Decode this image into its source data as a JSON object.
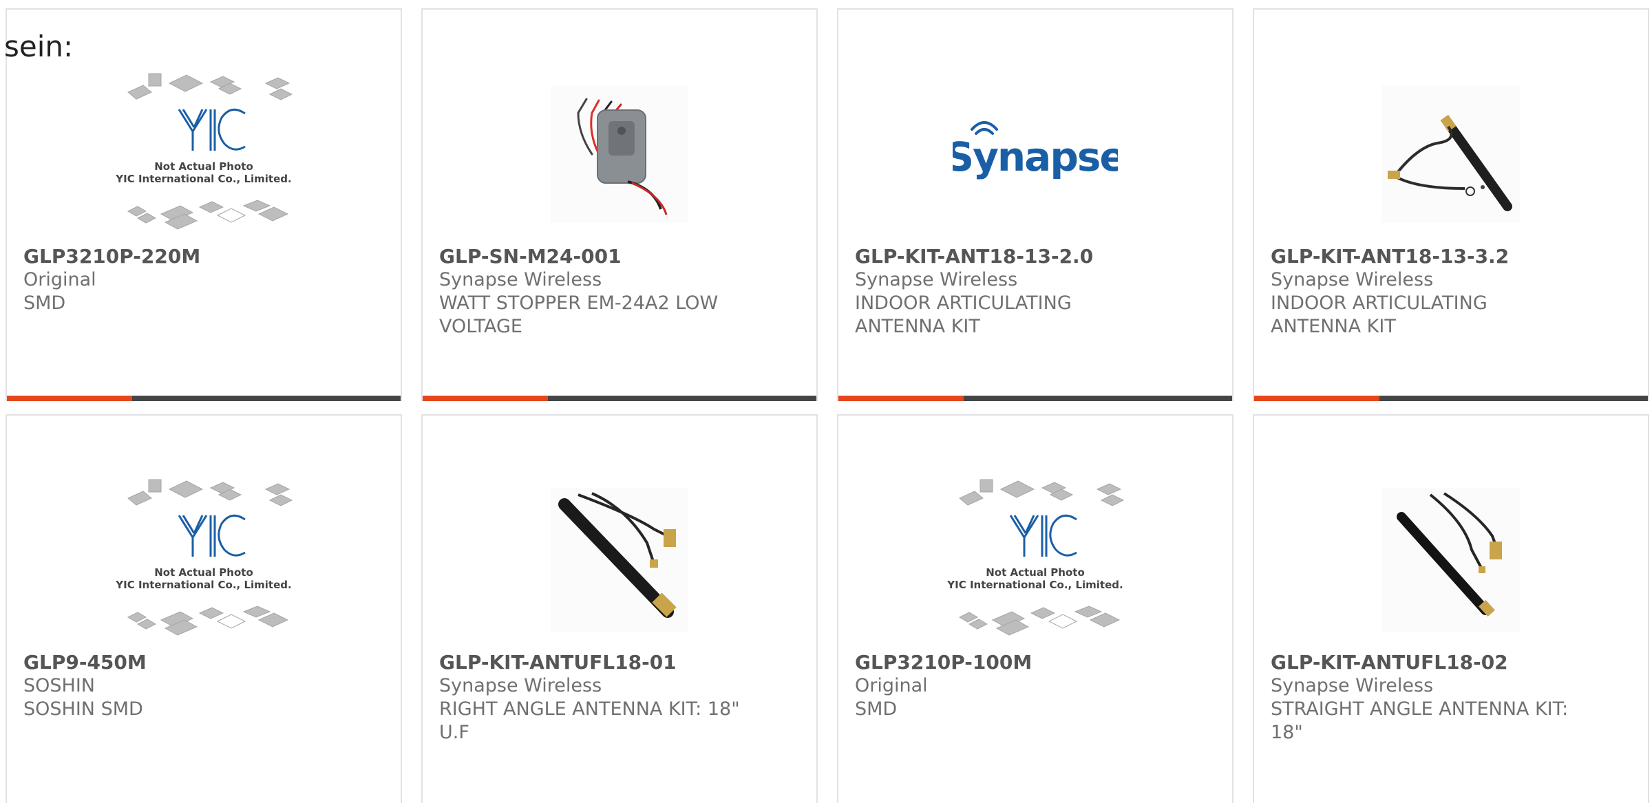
{
  "intro_text": "sein:",
  "placeholder": {
    "line1": "Not Actual Photo",
    "line2": "YIC International Co., Limited."
  },
  "brand_logo_text": "Synapse",
  "cards": [
    {
      "part": "GLP3210P-220M",
      "brand": "Original",
      "desc": "SMD",
      "image": "yic-placeholder"
    },
    {
      "part": "GLP-SN-M24-001",
      "brand": "Synapse Wireless",
      "desc": "WATT STOPPER EM-24A2 LOW VOLTAGE",
      "image": "sensor-photo"
    },
    {
      "part": "GLP-KIT-ANT18-13-2.0",
      "brand": "Synapse Wireless",
      "desc": "INDOOR ARTICULATING ANTENNA KIT",
      "image": "synapse-logo"
    },
    {
      "part": "GLP-KIT-ANT18-13-3.2",
      "brand": "Synapse Wireless",
      "desc": "INDOOR ARTICULATING ANTENNA KIT",
      "image": "antenna-cable-photo"
    },
    {
      "part": "GLP9-450M",
      "brand": "SOSHIN",
      "desc": "SOSHIN SMD",
      "image": "yic-placeholder"
    },
    {
      "part": "GLP-KIT-ANTUFL18-01",
      "brand": "Synapse Wireless",
      "desc": "RIGHT ANGLE ANTENNA KIT: 18\" U.F",
      "image": "right-angle-antenna-photo"
    },
    {
      "part": "GLP3210P-100M",
      "brand": "Original",
      "desc": "SMD",
      "image": "yic-placeholder"
    },
    {
      "part": "GLP-KIT-ANTUFL18-02",
      "brand": "Synapse Wireless",
      "desc": "STRAIGHT ANGLE ANTENNA KIT: 18\"",
      "image": "straight-antenna-photo"
    }
  ],
  "colors": {
    "accent": "#e5461b",
    "bar": "#454545",
    "logo_blue": "#1a5fa6"
  }
}
